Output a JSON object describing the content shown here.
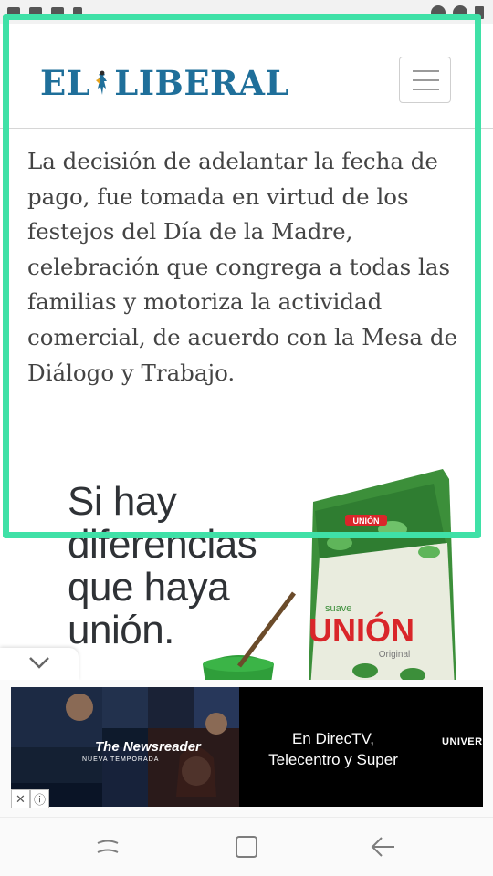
{
  "header": {
    "logo_text_left": "EL",
    "logo_text_right": "LIBERAL"
  },
  "article": {
    "paragraph": "La decisión de adelantar la fecha de pago, fue tomada en virtud de los festejos del Día de la Madre, celebración que congrega a todas las familias y motoriza la actividad comercial, de acuerdo con la Mesa de Diálogo y Trabajo."
  },
  "ad_yerba": {
    "slogan_lines": [
      "Si hay",
      "diferencias",
      "que haya",
      "unión."
    ],
    "brand_top": "UNIÓN",
    "brand_small": "suave",
    "brand_label": "UNIÓN",
    "brand_variant": "Original"
  },
  "banner_ad": {
    "show_title": "The Newsreader",
    "show_subtitle": "NUEVA TEMPORADA",
    "text_line1": "En DirecTV,",
    "text_line2": "Telecentro y Super",
    "brand": "UNIVERSAL+"
  },
  "colors": {
    "brand_blue": "#1f6f9a",
    "highlight": "#3fe1a7",
    "union_red": "#d9262a",
    "pack_green": "#3c8f3a"
  },
  "icons": {
    "menu": "hamburger-icon",
    "collapse": "chevron-down-icon",
    "ad_close": "close-icon",
    "ad_info": "info-icon",
    "nav_recents": "recents-icon",
    "nav_home": "home-icon",
    "nav_back": "back-arrow-icon"
  }
}
